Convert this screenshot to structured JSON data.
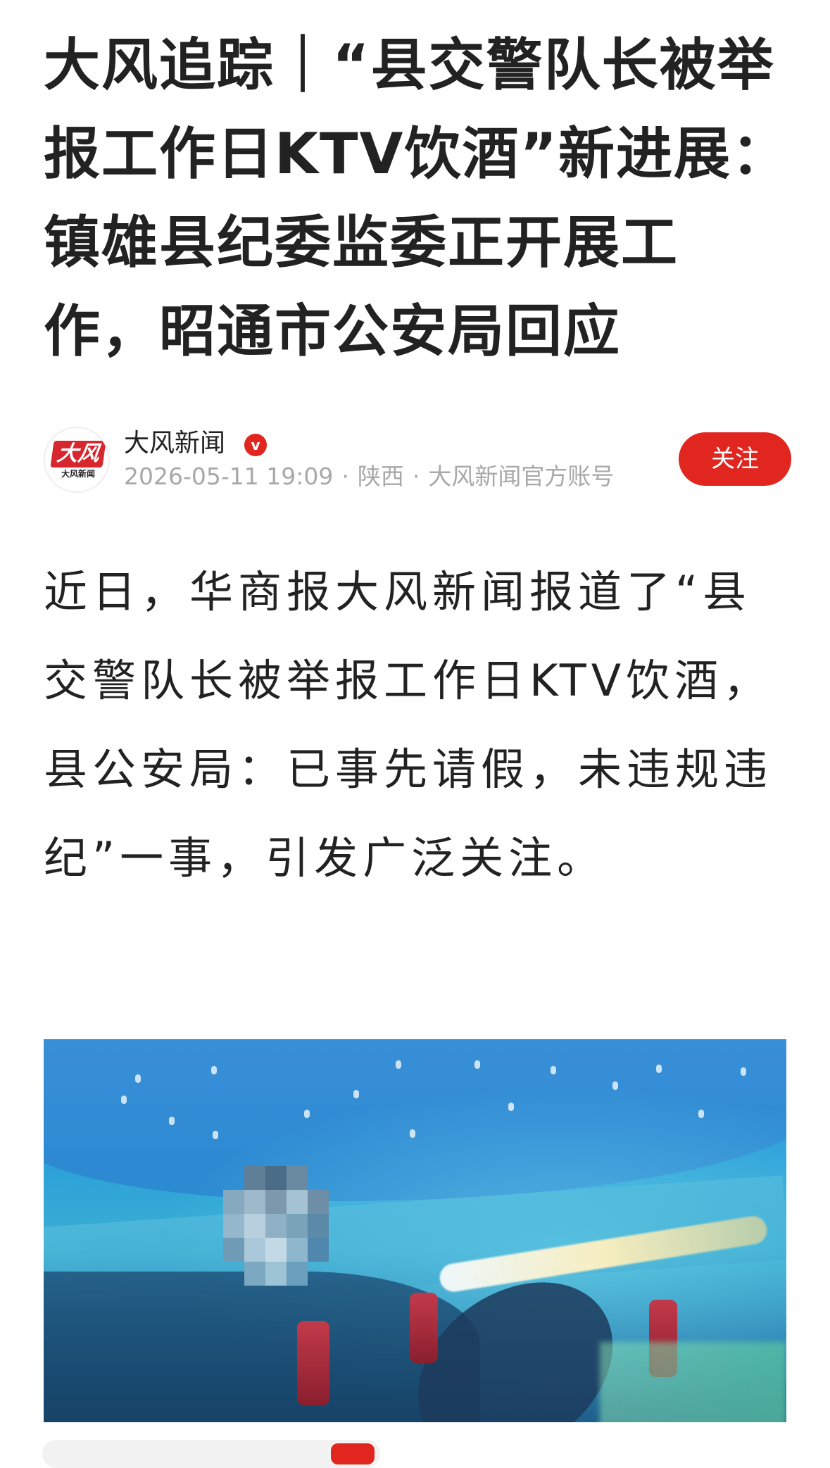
{
  "article": {
    "title": "大风追踪｜“县交警队长被举报工作日KTV饮酒”新进展：镇雄县纪委监委正开展工作，昭通市公安局回应",
    "author": {
      "name": "大风新闻",
      "avatar_logo_text": "大风",
      "avatar_logo_subtext": "大风新闻",
      "verified_icon": "verified-v-icon",
      "verified_glyph": "v",
      "datetime": "2026-05-11 19:09",
      "location": "陕西",
      "account_type": "大风新闻官方账号",
      "separator": "·",
      "follow_label": "关注"
    },
    "paragraphs": [
      "近日，华商报大风新闻报道了“县交警队长被举报工作日KTV饮酒，县公安局：已事先请假，未违规违纪”一事，引发广泛关注。"
    ],
    "image": {
      "subject": "KTV-room-photo-with-pixelated-face"
    }
  },
  "colors": {
    "accent": "#e0261f",
    "text": "#222222",
    "meta": "#a8a8a8",
    "background": "#ffffff"
  }
}
